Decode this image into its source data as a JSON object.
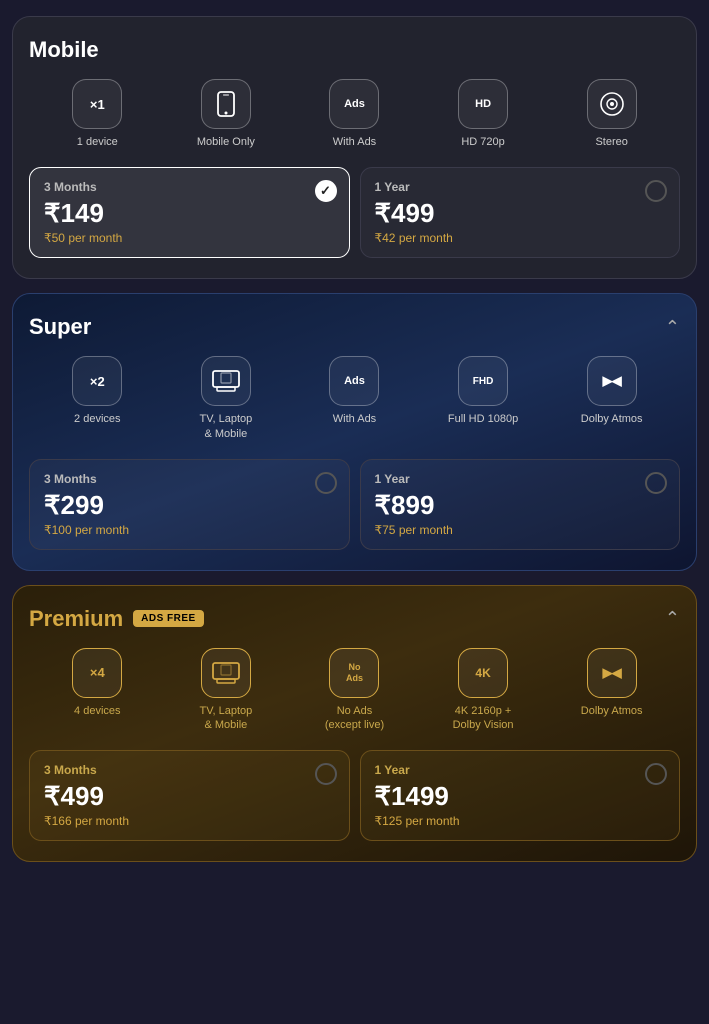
{
  "plans": [
    {
      "id": "mobile",
      "title": "Mobile",
      "title_color": "#fff",
      "card_class": "mobile",
      "show_ads_free": false,
      "show_chevron": false,
      "features": [
        {
          "id": "devices",
          "icon_type": "x1",
          "label": "1 device",
          "icon_text": "×1"
        },
        {
          "id": "screen",
          "icon_type": "mobile",
          "label": "Mobile Only",
          "icon_text": "📱"
        },
        {
          "id": "ads",
          "icon_type": "ads",
          "label": "With Ads",
          "icon_text": "Ads"
        },
        {
          "id": "quality",
          "icon_type": "hd",
          "label": "HD 720p",
          "icon_text": "HD"
        },
        {
          "id": "audio",
          "icon_type": "stereo",
          "label": "Stereo",
          "icon_text": "🔊"
        }
      ],
      "options": [
        {
          "period": "3 Months",
          "amount": "₹149",
          "per_month": "₹50 per month",
          "selected": true
        },
        {
          "period": "1 Year",
          "amount": "₹499",
          "per_month": "₹42 per month",
          "selected": false
        }
      ]
    },
    {
      "id": "super",
      "title": "Super",
      "title_color": "#fff",
      "card_class": "super",
      "show_ads_free": false,
      "show_chevron": true,
      "features": [
        {
          "id": "devices",
          "icon_type": "x2",
          "label": "2 devices",
          "icon_text": "×2"
        },
        {
          "id": "screen",
          "icon_type": "tv",
          "label": "TV, Laptop\n& Mobile",
          "icon_text": "🖥"
        },
        {
          "id": "ads",
          "icon_type": "ads",
          "label": "With Ads",
          "icon_text": "Ads"
        },
        {
          "id": "quality",
          "icon_type": "fhd",
          "label": "Full HD 1080p",
          "icon_text": "FHD"
        },
        {
          "id": "audio",
          "icon_type": "dolby",
          "label": "Dolby Atmos",
          "icon_text": "ᗡᗡ"
        }
      ],
      "options": [
        {
          "period": "3 Months",
          "amount": "₹299",
          "per_month": "₹100 per month",
          "selected": false
        },
        {
          "period": "1 Year",
          "amount": "₹899",
          "per_month": "₹75 per month",
          "selected": false
        }
      ]
    },
    {
      "id": "premium",
      "title": "Premium",
      "title_color": "#d4a843",
      "card_class": "premium",
      "show_ads_free": true,
      "ads_free_label": "ADS FREE",
      "show_chevron": true,
      "features": [
        {
          "id": "devices",
          "icon_type": "x4",
          "label": "4 devices",
          "icon_text": "×4"
        },
        {
          "id": "screen",
          "icon_type": "tv",
          "label": "TV, Laptop\n& Mobile",
          "icon_text": "🖥"
        },
        {
          "id": "ads",
          "icon_type": "no-ads",
          "label": "No Ads\n(except live)",
          "icon_text": "No\nAds"
        },
        {
          "id": "quality",
          "icon_type": "4k",
          "label": "4K 2160p +\nDolby Vision",
          "icon_text": "4K"
        },
        {
          "id": "audio",
          "icon_type": "dolby",
          "label": "Dolby Atmos",
          "icon_text": "ᗡᗡ"
        }
      ],
      "options": [
        {
          "period": "3 Months",
          "amount": "₹499",
          "per_month": "₹166 per month",
          "selected": false
        },
        {
          "period": "1 Year",
          "amount": "₹1499",
          "per_month": "₹125 per month",
          "selected": false
        }
      ]
    }
  ]
}
